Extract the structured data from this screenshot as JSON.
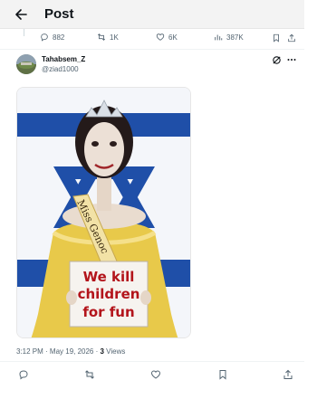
{
  "header": {
    "title": "Post"
  },
  "metrics": {
    "replies": "882",
    "reposts": "1K",
    "likes": "6K",
    "views": "387K"
  },
  "author": {
    "name": "Tahabsem_Z",
    "handle": "@ziad1000"
  },
  "media": {
    "sash_text": "Miss Genoc",
    "sign_lines": [
      "We kill",
      "children",
      "for fun"
    ]
  },
  "meta": {
    "time": "3:12 PM · May 19, 2026 · ",
    "views_count": "3",
    "views_label": " Views"
  },
  "colors": {
    "muted": "#536471",
    "flag_blue": "#1f4fa8",
    "dress_yellow": "#e8c94a",
    "sign_red": "#b3141b"
  }
}
